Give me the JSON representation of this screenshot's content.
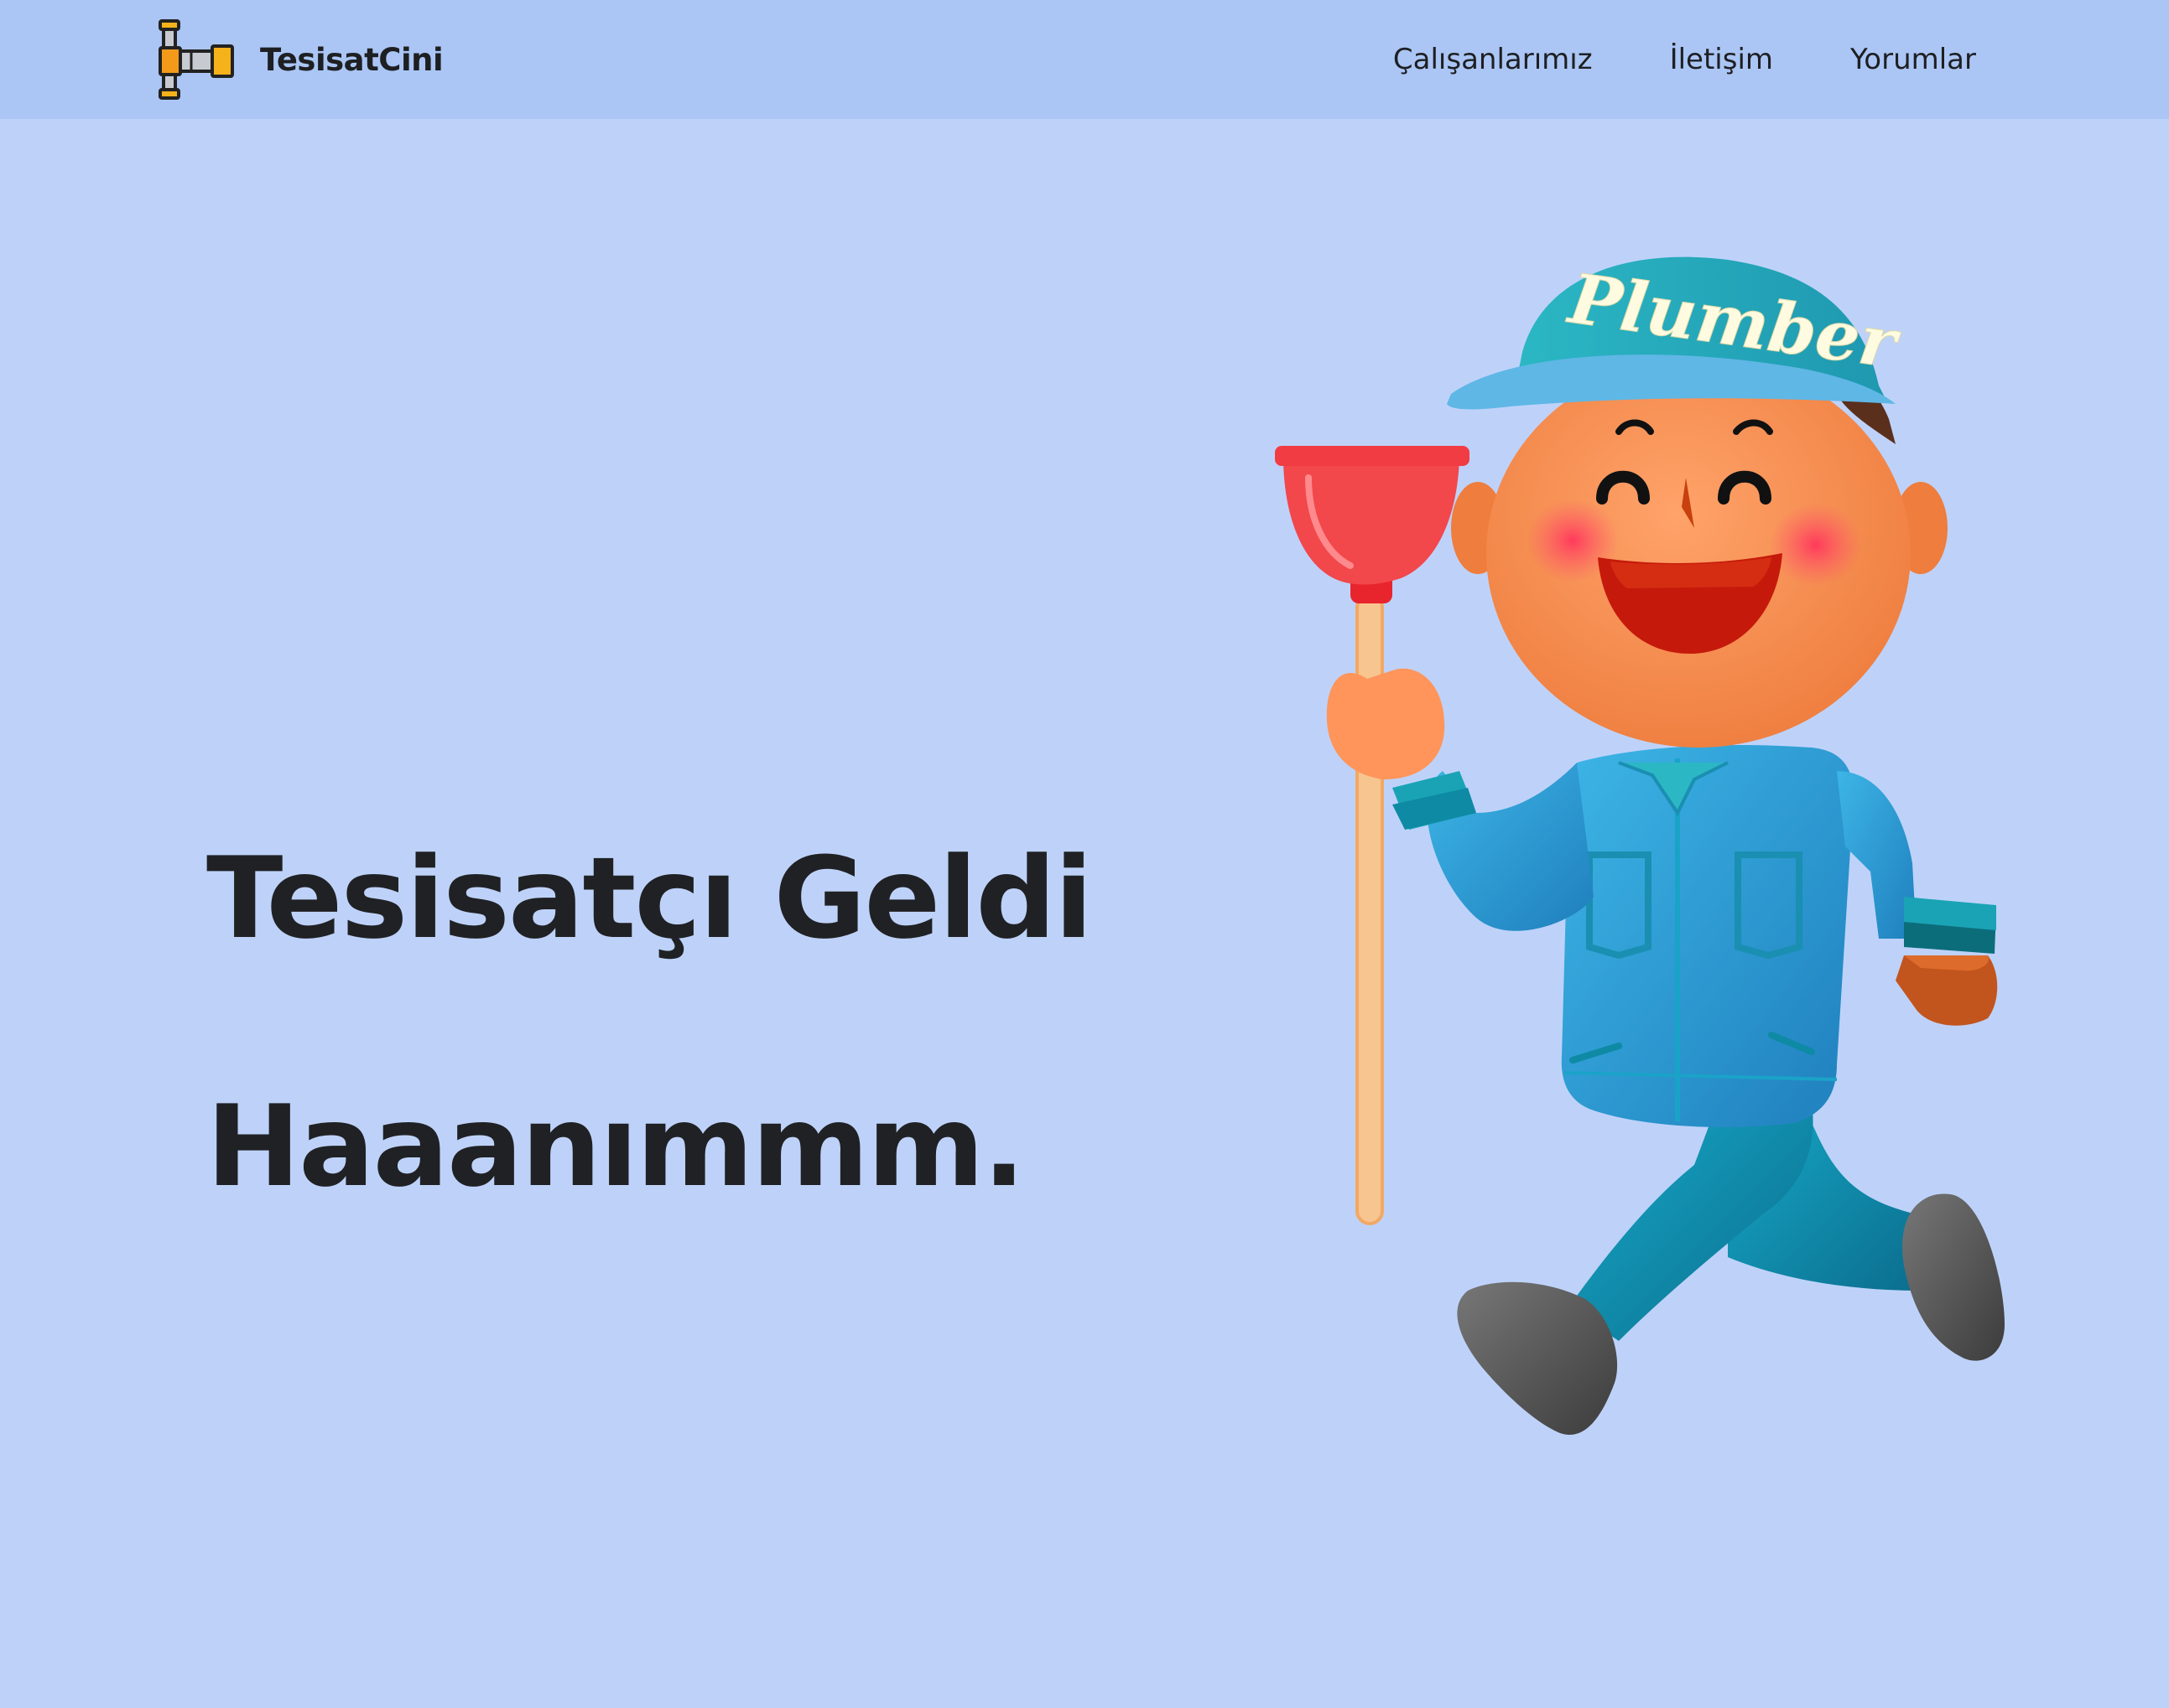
{
  "nav": {
    "brand": "TesisatCini",
    "logo_icon": "pipe-fitting-icon",
    "links": [
      "Çalışanlarımız",
      "İletişim",
      "Yorumlar"
    ]
  },
  "hero": {
    "title_line1": "Tesisatçı Geldi",
    "title_line2": "Haaanımmm.",
    "illustration": {
      "icon": "plumber-mascot-illustration",
      "cap_text": "Plumber"
    }
  },
  "colors": {
    "navbar": "#abc6f5",
    "background": "#bed2f9",
    "text": "#1e1f22",
    "uniform": "#2aa3dc",
    "cap": "#2bb7c4",
    "plunger": "#f2474b"
  }
}
